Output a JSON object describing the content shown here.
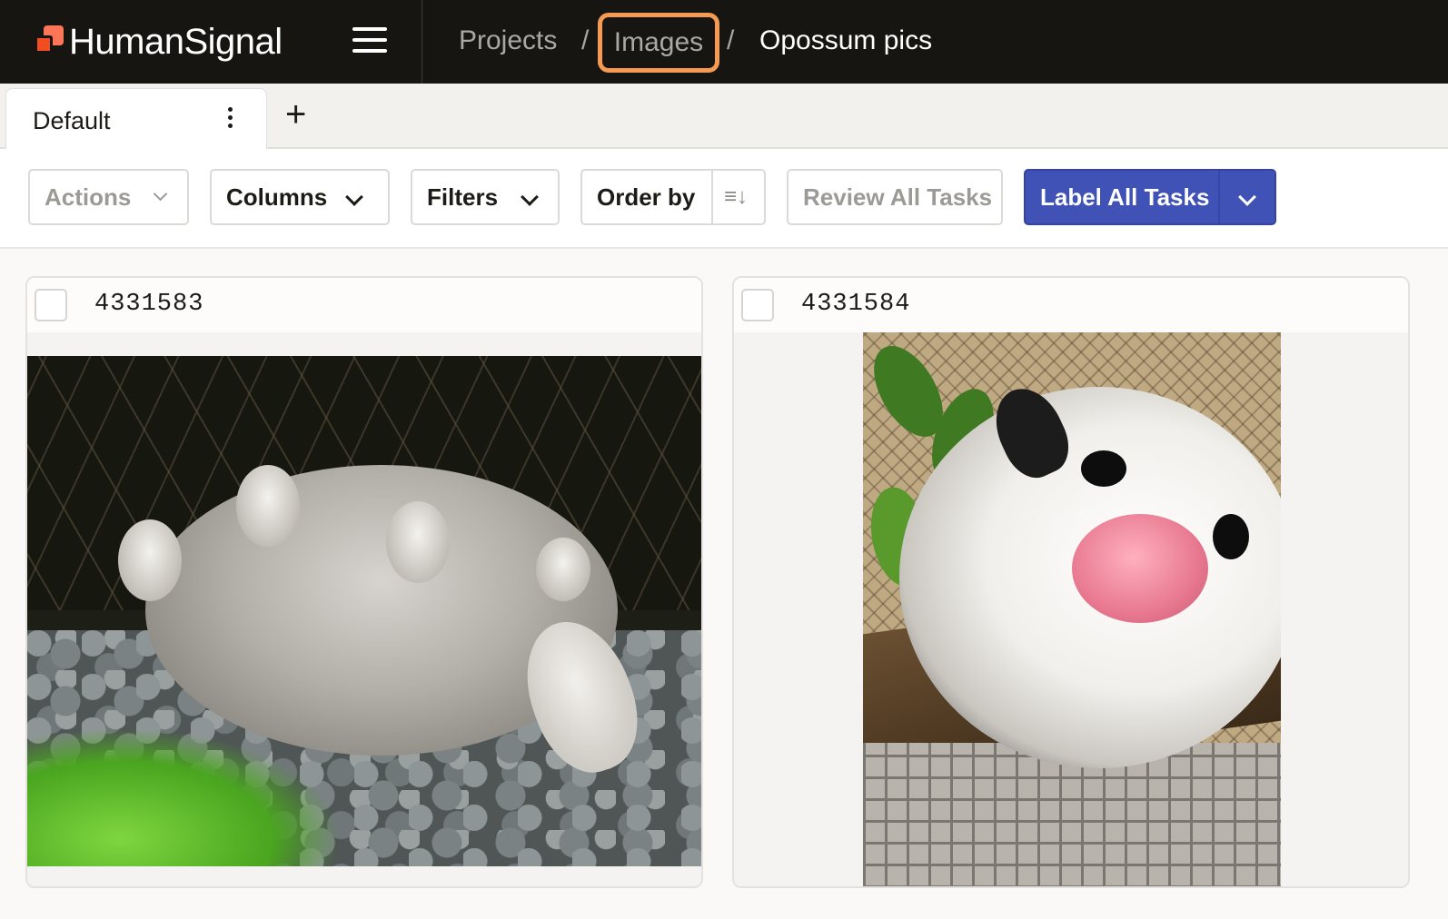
{
  "app": {
    "brand": "HumanSignal"
  },
  "breadcrumb": {
    "items": [
      "Projects",
      "Images",
      "Opossum pics"
    ],
    "separator": "/"
  },
  "tabs": {
    "items": [
      {
        "label": "Default"
      }
    ],
    "add_label": "+"
  },
  "toolbar": {
    "actions_label": "Actions",
    "columns_label": "Columns",
    "filters_label": "Filters",
    "order_by_label": "Order by",
    "review_label": "Review All Tasks",
    "label_all_label": "Label All Tasks"
  },
  "tasks": [
    {
      "id": "4331583"
    },
    {
      "id": "4331584"
    }
  ],
  "colors": {
    "accent": "#4052b5",
    "topbar": "#161511",
    "highlight": "#f59a52",
    "brand_orange": "#f04d23"
  },
  "icons": {
    "menu": "hamburger-icon",
    "tab_options": "vertical-dots-icon",
    "add_tab": "plus-icon",
    "dropdown": "chevron-down-icon",
    "sort": "sort-direction-icon"
  }
}
